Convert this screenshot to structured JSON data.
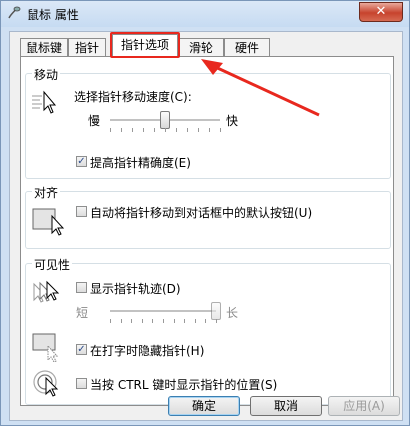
{
  "window": {
    "title": "鼠标 属性",
    "close_label": "✕"
  },
  "tabs": [
    {
      "label": "鼠标键"
    },
    {
      "label": "指针"
    },
    {
      "label": "指针选项"
    },
    {
      "label": "滑轮"
    },
    {
      "label": "硬件"
    }
  ],
  "motion": {
    "title": "移动",
    "speed_label": "选择指针移动速度(C):",
    "slow": "慢",
    "fast": "快",
    "speed_value_fraction": 0.5,
    "precision_label": "提高指针精确度(E)",
    "precision_checked": true
  },
  "snap": {
    "title": "对齐",
    "snap_label": "自动将指针移动到对话框中的默认按钮(U)",
    "snap_checked": false
  },
  "visibility": {
    "title": "可见性",
    "trails_label": "显示指针轨迹(D)",
    "trails_checked": false,
    "short": "短",
    "long": "长",
    "trail_length_fraction": 1.0,
    "hide_typing_label": "在打字时隐藏指针(H)",
    "hide_typing_checked": true,
    "ctrl_label": "当按 CTRL 键时显示指针的位置(S)",
    "ctrl_checked": false
  },
  "buttons": {
    "ok": "确定",
    "cancel": "取消",
    "apply": "应用(A)"
  },
  "colors": {
    "annotation_red": "#e8281e",
    "title_blue": "#cfe0f3"
  }
}
